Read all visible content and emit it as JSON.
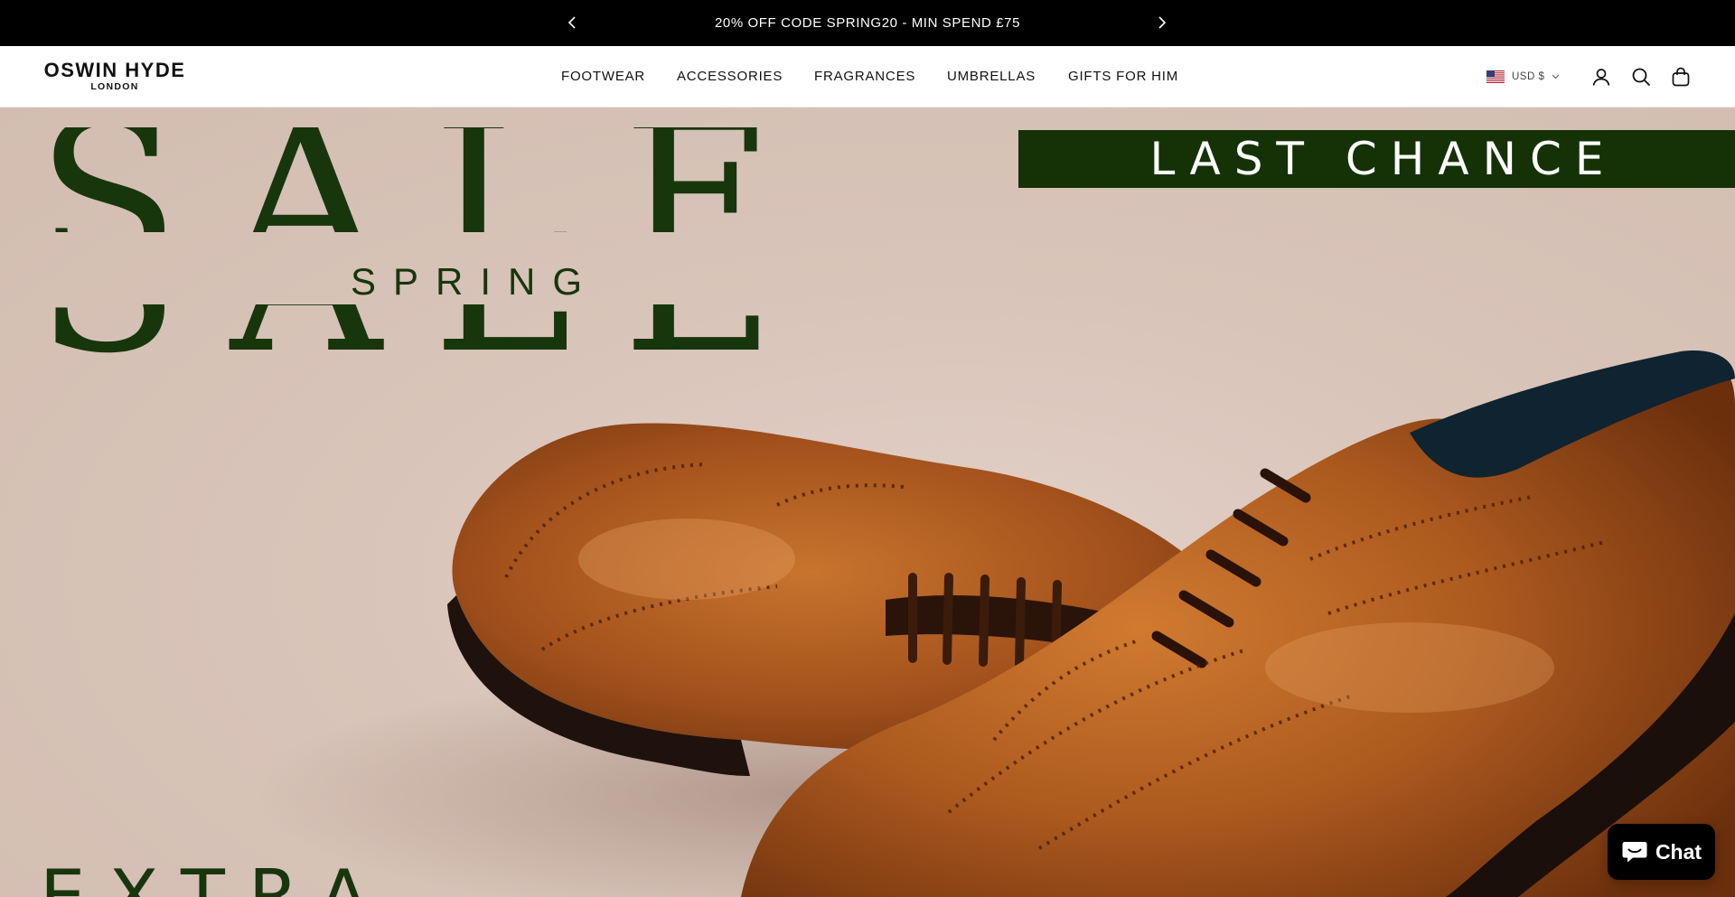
{
  "announcement": {
    "message": "20% OFF CODE SPRING20 - MIN SPEND £75"
  },
  "header": {
    "logo_brand": "OSWIN HYDE",
    "logo_sub": "LONDON",
    "nav": [
      "FOOTWEAR",
      "ACCESSORIES",
      "FRAGRANCES",
      "UMBRELLAS",
      "GIFTS FOR HIM"
    ],
    "currency": "USD $"
  },
  "hero": {
    "headline": "SALE",
    "subheadline": "SPRING",
    "banner": "LAST CHANCE",
    "bottom_text": "EXTRA"
  },
  "chat": {
    "label": "Chat"
  },
  "colors": {
    "announcement_bg": "#000000",
    "accent_green": "#143206",
    "hero_bg": "#d9c4b9",
    "leather": "#a4521c"
  },
  "icons": [
    "chevron-left-icon",
    "chevron-right-icon",
    "us-flag-icon",
    "chevron-down-icon",
    "account-icon",
    "search-icon",
    "cart-icon",
    "chat-bubble-icon"
  ]
}
